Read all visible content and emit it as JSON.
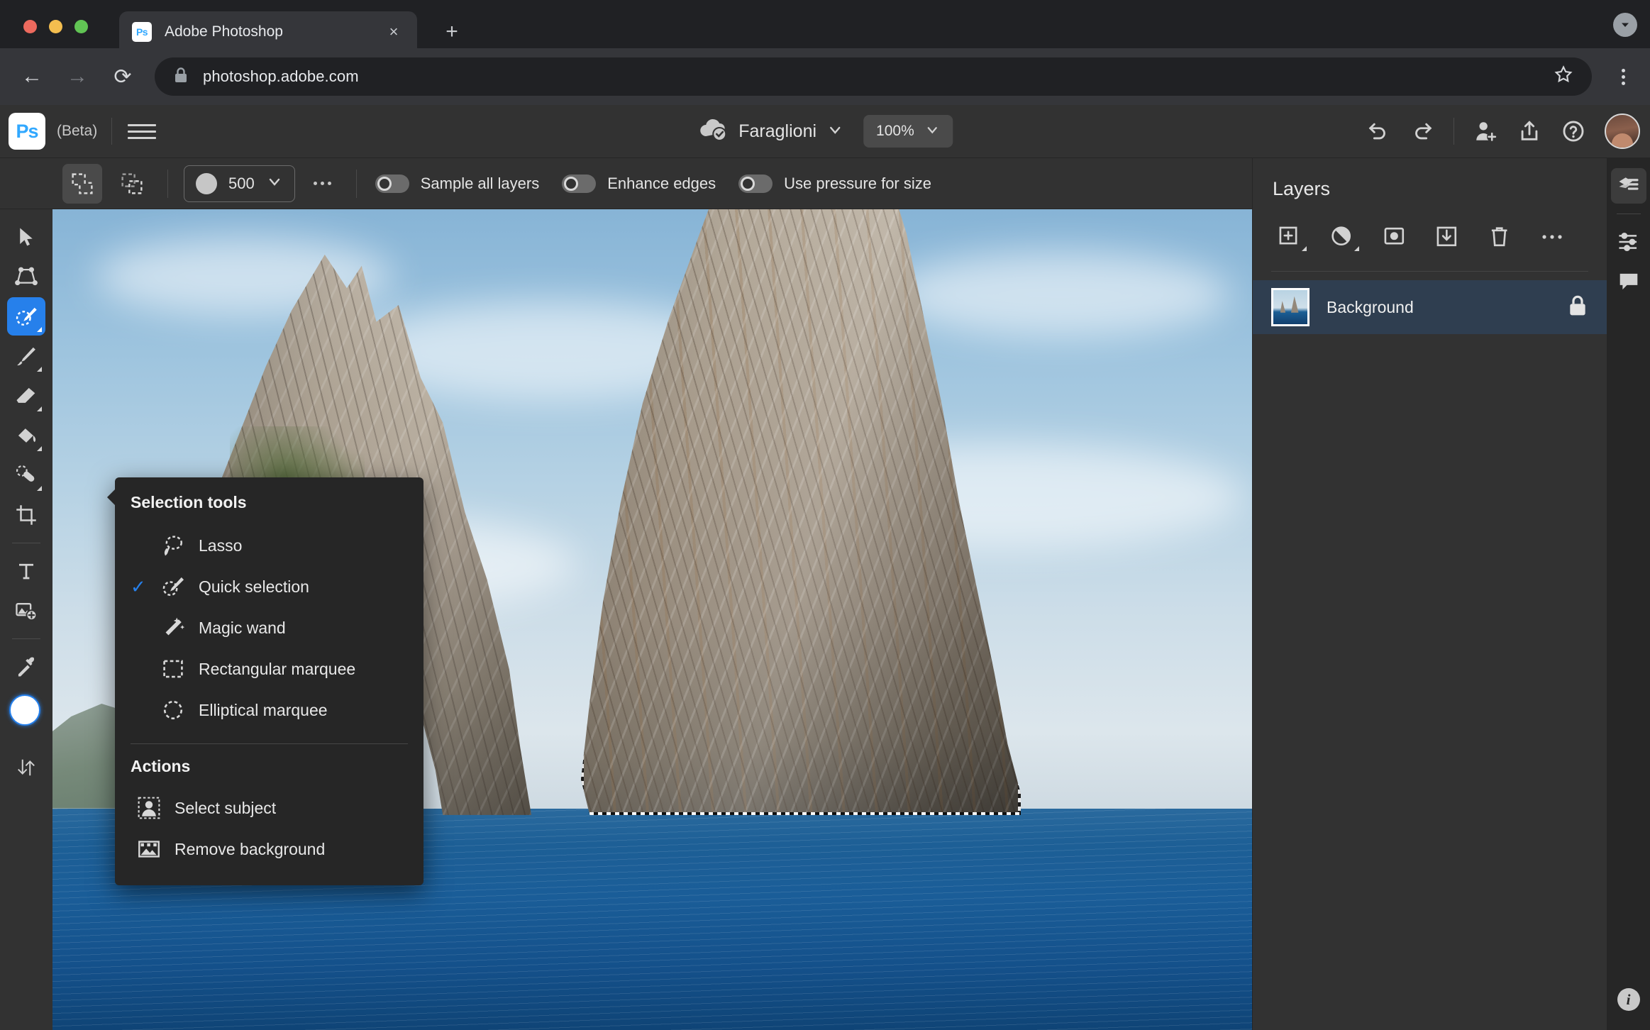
{
  "browser": {
    "tab": {
      "title": "Adobe Photoshop",
      "favicon": "Ps",
      "close_label": "×"
    },
    "new_tab_label": "+",
    "url": "photoshop.adobe.com",
    "back_label": "←",
    "forward_label": "→",
    "reload_label": "⟳"
  },
  "ps_header": {
    "logo": "Ps",
    "beta": "(Beta)",
    "document_name": "Faraglioni",
    "zoom_level": "100%",
    "chevron": "⌄"
  },
  "options_bar": {
    "brush_size": "500",
    "toggles": [
      {
        "label": "Sample all layers",
        "on": false
      },
      {
        "label": "Enhance edges",
        "on": false
      },
      {
        "label": "Use pressure for size",
        "on": false
      }
    ]
  },
  "toolbar": {
    "tools": [
      {
        "name": "move-tool",
        "active": false,
        "has_flyout": false
      },
      {
        "name": "transform-tool",
        "active": false,
        "has_flyout": false
      },
      {
        "name": "quick-selection-tool",
        "active": true,
        "has_flyout": true
      },
      {
        "name": "brush-tool",
        "active": false,
        "has_flyout": true
      },
      {
        "name": "eraser-tool",
        "active": false,
        "has_flyout": true
      },
      {
        "name": "paint-bucket-tool",
        "active": false,
        "has_flyout": true
      },
      {
        "name": "healing-brush-tool",
        "active": false,
        "has_flyout": true
      },
      {
        "name": "crop-tool",
        "active": false,
        "has_flyout": false
      },
      {
        "name": "type-tool",
        "active": false,
        "has_flyout": false
      },
      {
        "name": "place-image-tool",
        "active": false,
        "has_flyout": false
      },
      {
        "name": "eyedropper-tool",
        "active": false,
        "has_flyout": false
      }
    ],
    "swap_colors_label": "⇅"
  },
  "flyout": {
    "section_selection": "Selection tools",
    "section_actions": "Actions",
    "check_glyph": "✓",
    "selection_tools": [
      {
        "label": "Lasso",
        "icon": "lasso-icon",
        "checked": false
      },
      {
        "label": "Quick selection",
        "icon": "quick-selection-icon",
        "checked": true
      },
      {
        "label": "Magic wand",
        "icon": "magic-wand-icon",
        "checked": false
      },
      {
        "label": "Rectangular marquee",
        "icon": "rectangular-marquee-icon",
        "checked": false
      },
      {
        "label": "Elliptical marquee",
        "icon": "elliptical-marquee-icon",
        "checked": false
      }
    ],
    "actions": [
      {
        "label": "Select subject",
        "icon": "select-subject-icon"
      },
      {
        "label": "Remove background",
        "icon": "remove-background-icon"
      }
    ]
  },
  "layers_panel": {
    "title": "Layers",
    "actions": [
      "add-layer-button",
      "adjustment-layer-button",
      "layer-mask-button",
      "merge-down-button",
      "delete-layer-button",
      "more-options-button"
    ],
    "layers": [
      {
        "name": "Background",
        "locked": true,
        "selected": true
      }
    ]
  },
  "rail": {
    "buttons": [
      "layers-panel-button",
      "properties-panel-button",
      "comments-panel-button"
    ],
    "info_label": "i"
  },
  "colors": {
    "accent": "#2680EB",
    "chrome_bg": "#202124",
    "omnibar_bg": "#35363A",
    "ps_bg": "#323232",
    "panel_bg": "#262626",
    "layer_selected": "#2F3E50"
  }
}
